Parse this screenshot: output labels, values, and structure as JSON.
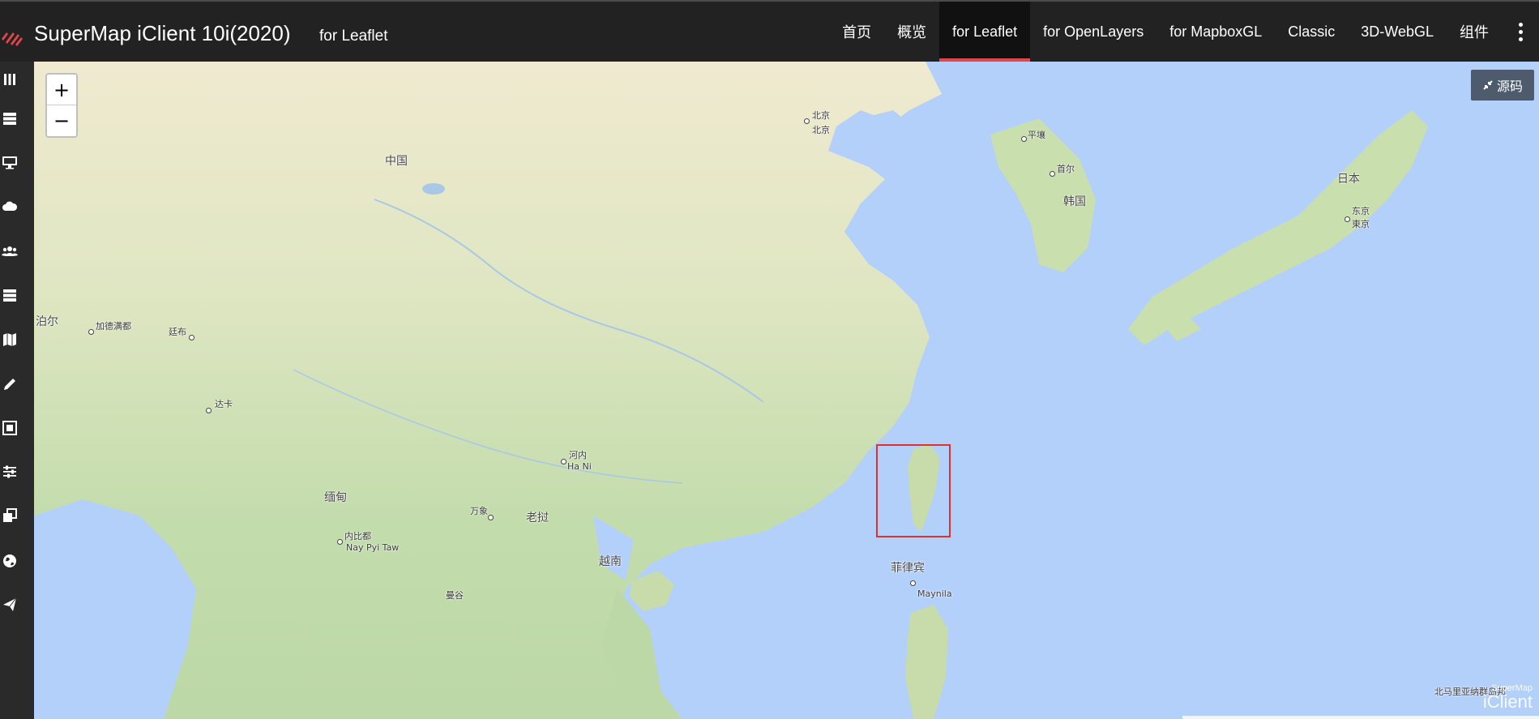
{
  "header": {
    "brand": "SuperMap iClient 10i(2020)",
    "brand_sub": "for Leaflet",
    "logo_icon": "supermap-logo-icon",
    "accent_color": "#e0464a",
    "nav": [
      {
        "label": "首页",
        "active": false
      },
      {
        "label": "概览",
        "active": false
      },
      {
        "label": "for Leaflet",
        "active": true
      },
      {
        "label": "for OpenLayers",
        "active": false
      },
      {
        "label": "for MapboxGL",
        "active": false
      },
      {
        "label": "Classic",
        "active": false
      },
      {
        "label": "3D-WebGL",
        "active": false
      },
      {
        "label": "组件",
        "active": false
      }
    ],
    "more_icon": "vertical-dots-icon"
  },
  "sidebar": {
    "icons": [
      "columns-icon",
      "server-icon",
      "desktop-icon",
      "cloud-icon",
      "users-icon",
      "database-icon",
      "map-icon",
      "pencil-icon",
      "frame-icon",
      "sliders-icon",
      "clone-icon",
      "globe-icon",
      "paper-plane-icon"
    ]
  },
  "map": {
    "zoom_in": "+",
    "zoom_out": "−",
    "source_button": "源码",
    "source_icon": "compress-icon",
    "labels": {
      "china": "中国",
      "beijing_a": "北京",
      "beijing_b": "北京",
      "pyongyang": "平壤",
      "seoul": "首尔",
      "korea": "韩国",
      "japan": "日本",
      "tokyo_a": "东京",
      "tokyo_b": "東京",
      "nepal": "泊尔",
      "kathmandu": "加德满都",
      "thimphu": "廷布",
      "dhaka": "达卡",
      "hanoi": "河内",
      "hanoi_en": "Ha Ni",
      "myanmar": "缅甸",
      "naypyitaw": "内比都",
      "naypyitaw_en": "Nay Pyi Taw",
      "vientiane": "万象",
      "laos": "老挝",
      "vietnam": "越南",
      "philippines": "菲律宾",
      "manila": "Maynila",
      "bangkok": "曼谷",
      "micronesia": "北马里亚纳群岛邦"
    },
    "watermark_top": "SuperMap",
    "watermark_main": "iClient",
    "water_color": "#b3d0fb",
    "land_color": "#c8dcae",
    "highlight_color": "#e03030"
  }
}
